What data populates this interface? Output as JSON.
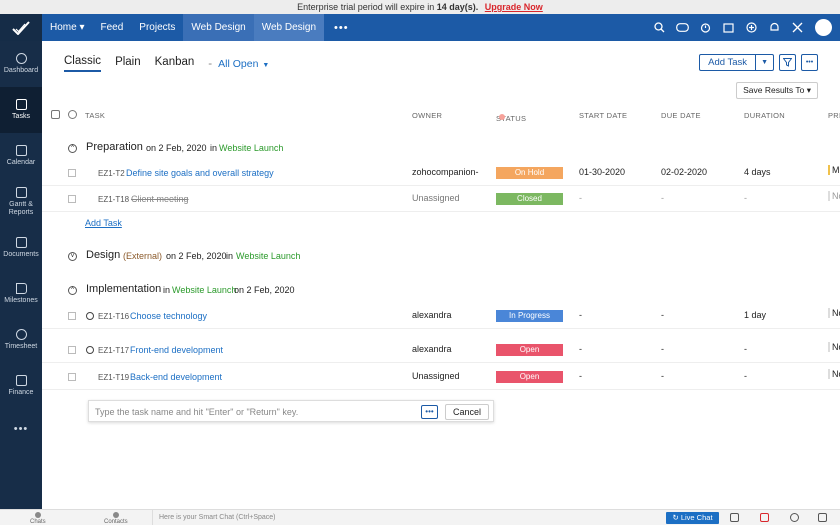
{
  "banner": {
    "text_before": "Enterprise trial period will expire in",
    "days": "14 day(s).",
    "upgrade": "Upgrade Now"
  },
  "nav": {
    "items": [
      "Home",
      "Feed",
      "Projects",
      "Web Design",
      "Web Design"
    ],
    "home_caret": "▾",
    "more": "•••"
  },
  "sidebar": {
    "items": [
      "Dashboard",
      "Tasks",
      "Calendar",
      "Gantt & Reports",
      "Documents",
      "Milestones",
      "Timesheet",
      "Finance"
    ],
    "more": "•••"
  },
  "views": {
    "classic": "Classic",
    "plain": "Plain",
    "kanban": "Kanban",
    "sep": "-",
    "filter": "All Open"
  },
  "actions": {
    "add_task": "Add Task",
    "more": "•••",
    "save_results": "Save Results To ▾"
  },
  "columns": {
    "task": "TASK",
    "owner": "OWNER",
    "status": "STATUS",
    "start": "START DATE",
    "due": "DUE DATE",
    "duration": "DURATION",
    "priority": "PRI"
  },
  "groups": {
    "preparation": {
      "name": "Preparation",
      "date": "on 2 Feb, 2020",
      "in": "in",
      "milestone": "Website Launch"
    },
    "design": {
      "name": "Design",
      "ext": "(External)",
      "date": "on 2 Feb, 2020",
      "in": "in",
      "milestone": "Website Launch"
    },
    "implementation": {
      "name": "Implementation",
      "in": "in",
      "milestone": "Website Launch",
      "date": "on 2 Feb, 2020"
    }
  },
  "tasks": [
    {
      "id": "EZ1-T2",
      "name": "Define site goals and overall strategy",
      "owner": "zohocompanion-",
      "status": "On Hold",
      "status_color": "#f4a65f",
      "start": "01-30-2020",
      "due": "02-02-2020",
      "duration": "4 days",
      "pri": "M"
    },
    {
      "id": "EZ1-T18",
      "name": "Client meeting",
      "owner": "Unassigned",
      "status": "Closed",
      "status_color": "#7cb861",
      "start": "-",
      "due": "-",
      "duration": "-",
      "pri": "No"
    },
    {
      "id": "EZ1-T16",
      "name": "Choose technology",
      "owner": "alexandra",
      "status": "In Progress",
      "status_color": "#4a86d8",
      "start": "-",
      "due": "-",
      "duration": "1 day",
      "pri": "No"
    },
    {
      "id": "EZ1-T17",
      "name": "Front-end development",
      "owner": "alexandra",
      "status": "Open",
      "status_color": "#e9546b",
      "start": "-",
      "due": "-",
      "duration": "-",
      "pri": "No"
    },
    {
      "id": "EZ1-T19",
      "name": "Back-end development",
      "owner": "Unassigned",
      "status": "Open",
      "status_color": "#e9546b",
      "start": "-",
      "due": "-",
      "duration": "-",
      "pri": "No"
    }
  ],
  "add_task_link": "Add Task",
  "quick_add": {
    "placeholder": "Type the task name and hit \"Enter\" or \"Return\" key.",
    "more": "•••",
    "cancel": "Cancel"
  },
  "bottom": {
    "chats": "Chats",
    "contacts": "Contacts",
    "smart_chat": "Here is your Smart Chat (Ctrl+Space)",
    "live_chat": "Live Chat"
  }
}
